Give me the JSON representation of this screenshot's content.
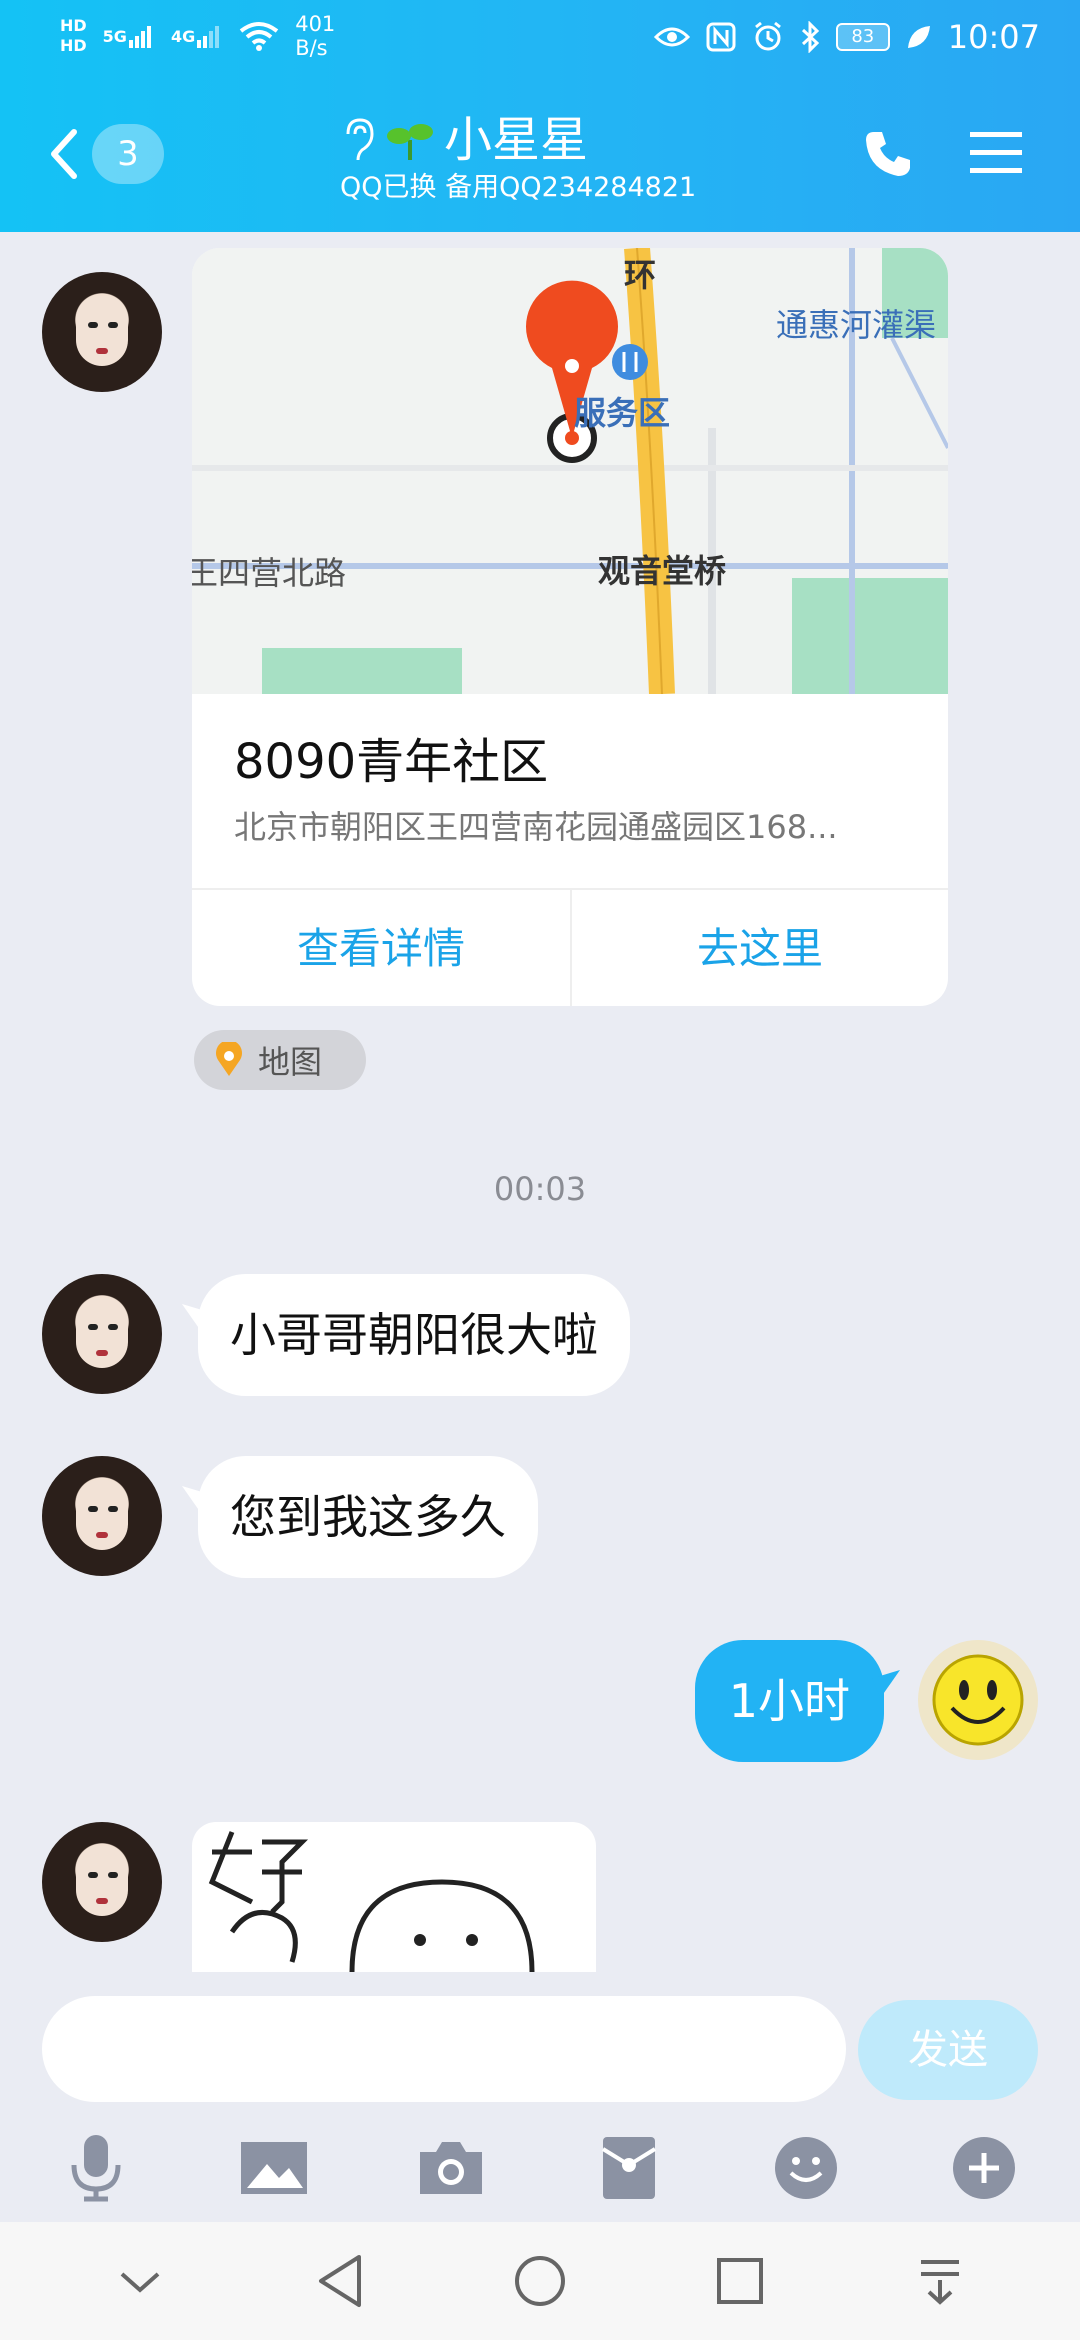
{
  "status_bar": {
    "net_badges": [
      "HD",
      "HD"
    ],
    "signal_labels": [
      "5G",
      "4G"
    ],
    "rate_value": "401",
    "rate_unit": "B/s",
    "battery": "83",
    "time": "10:07"
  },
  "header": {
    "back_badge": "3",
    "contact_name": "小星星",
    "subtitle": "QQ已换  备用QQ234284821"
  },
  "map_card": {
    "map_labels": {
      "huan": "环",
      "canal": "通惠河灌渠",
      "service_area": "服务区",
      "road": "王四营北路",
      "bridge": "观音堂桥"
    },
    "place_name": "8090青年社区",
    "address": "北京市朝阳区王四营南花园通盛园区168...",
    "action_details": "查看详情",
    "action_go": "去这里",
    "tag_label": "地图"
  },
  "timestamp": "00:03",
  "messages": [
    {
      "text": "小哥哥朝阳很大啦"
    },
    {
      "text": "您到我这多久"
    },
    {
      "text": "1小时"
    }
  ],
  "input": {
    "placeholder": "",
    "send_label": "发送"
  },
  "colors": {
    "header_start": "#14c2f5",
    "header_end": "#2aa7f3",
    "outgoing_bubble": "#22b3f4",
    "link_blue": "#1aa3e8",
    "send_disabled": "#bfeafb",
    "map_pin": "#ef4b1f",
    "road_yellow": "#f7c343"
  },
  "icons": {
    "toolbar": [
      "microphone-icon",
      "image-icon",
      "camera-icon",
      "red-packet-icon",
      "emoji-icon",
      "plus-icon"
    ],
    "navbar": [
      "collapse-icon",
      "back-triangle-icon",
      "home-circle-icon",
      "recents-square-icon",
      "notification-pull-icon"
    ]
  }
}
